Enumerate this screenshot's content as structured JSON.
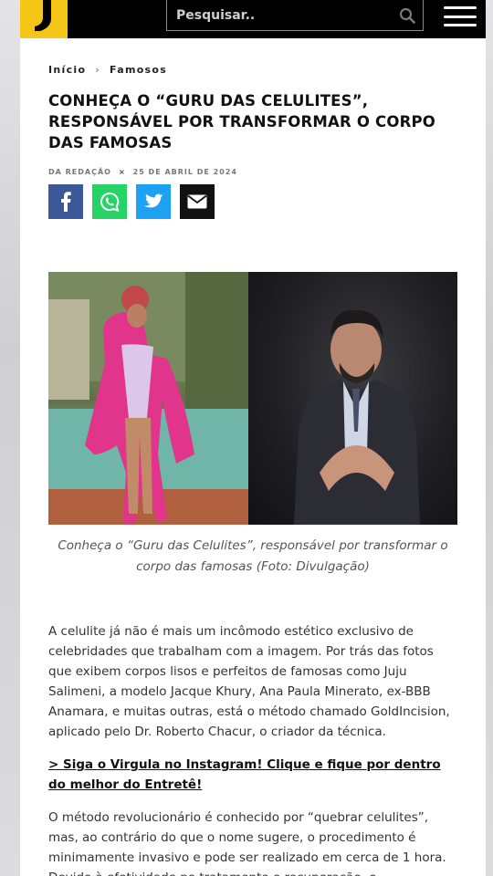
{
  "header": {
    "search_placeholder": "Pesquisar..",
    "icons": {
      "logo": "virgula-logo",
      "search": "search-icon",
      "menu": "hamburger-menu-icon"
    },
    "colors": {
      "logo_bg": "#f5c518",
      "bar_bg": "#000000"
    }
  },
  "breadcrumb": {
    "home": "Início",
    "separator": "›",
    "section": "Famosos"
  },
  "article": {
    "title": "CONHEÇA O “GURU DAS CELULITES”, RESPONSÁVEL POR TRANSFORMAR O CORPO DAS FAMOSAS",
    "author": "DA REDAÇÃO",
    "byline_separator": "×",
    "date": "25 DE ABRIL DE 2024",
    "share": [
      {
        "network": "facebook",
        "icon": "facebook-icon",
        "color": "#3b5998"
      },
      {
        "network": "whatsapp",
        "icon": "whatsapp-icon",
        "color": "#25d366"
      },
      {
        "network": "twitter",
        "icon": "twitter-icon",
        "color": "#1da1f2"
      },
      {
        "network": "email",
        "icon": "envelope-icon",
        "color": "#111111"
      }
    ],
    "image_caption": "Conheça o “Guru das Celulites”, responsável por transformar o corpo das famosas (Foto: Divulgação)",
    "paragraph_1": "A celulite já não é mais um incômodo estético exclusivo de celebridades que trabalham com a imagem. Por trás das fotos que exibem corpos lisos e perfeitos de famosas como Juju Salimeni, a modelo Jacque Khury, Ana Paula Minerato, ex-BBB Anamara, e muitas outras, está o método chamado GoldIncision, aplicado pelo Dr. Roberto Chacur, o criador da técnica.",
    "instagram_link": "> Siga o Virgula no Instagram! Clique e fique por dentro do melhor do Entretê!",
    "paragraph_2": "O método revolucionário é conhecido por “quebrar celulites”, mas, ao contrário do que o nome sugere, o procedimento é minimamente invasivo e pode ser realizado em cerca de 1 hora. Devido à efetividade no tratamento e recuperação, o"
  }
}
